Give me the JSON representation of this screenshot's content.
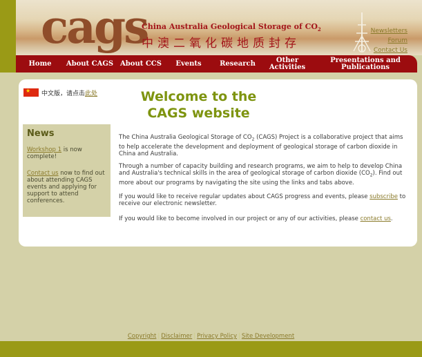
{
  "header": {
    "logo_text": "cags",
    "title_en_prefix": "China Australia Geological Storage of CO",
    "title_en_sub": "2",
    "title_cn": "中澳二氧化碳地质封存",
    "links": [
      "Newsletters",
      "Forum",
      "Contact Us"
    ]
  },
  "nav": {
    "items": [
      {
        "label": "Home"
      },
      {
        "label": "About CAGS"
      },
      {
        "label": "About CCS"
      },
      {
        "label": "Events"
      },
      {
        "label": "Research"
      },
      {
        "label": "Other Activities"
      },
      {
        "label": "Presentations and Publications"
      }
    ]
  },
  "chinese_note": {
    "text": "中文版，请点击",
    "link": "此处"
  },
  "welcome": "Welcome to the CAGS website",
  "news": {
    "title": "News",
    "item1_link": "Workshop 1",
    "item1_text": " is now complete!",
    "item2_link": "Contact us",
    "item2_text": " now to find out about attending CAGS events and applying for support to attend conferences."
  },
  "main": {
    "p1_a": "The China Australia Geological Storage of CO",
    "p1_sub": "2",
    "p1_b": " (CAGS) Project is a collaborative project that aims to help accelerate the development and deployment of geological storage of carbon dioxide in China and Australia.",
    "p2_a": "Through a number of capacity building and research programs, we aim to help to develop China and Australia's technical skills in the area of geological storage of carbon dioxide (CO",
    "p2_sub": "2",
    "p2_b": "). Find out more about our programs by navigating the site using the links and tabs above.",
    "p3_a": "If you would like to receive regular updates about CAGS progress and events, please ",
    "p3_link": "subscribe",
    "p3_b": " to receive our electronic newsletter.",
    "p4_a": "If you would like to become involved in our project or any of our activities, please ",
    "p4_link": "contact us",
    "p4_b": "."
  },
  "footer": {
    "links": [
      "Copyright",
      "Disclaimer",
      "Privacy Policy",
      "Site Development"
    ]
  },
  "colors": {
    "nav_bg": "#9c0c0f",
    "olive": "#9a9a16",
    "welcome_green": "#7e9410",
    "link_olive": "#8a7a2a"
  }
}
